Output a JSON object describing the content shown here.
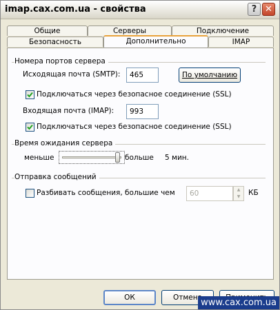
{
  "window": {
    "title": "imap.cax.com.ua - свойства",
    "help_label": "?",
    "close_label": "✕"
  },
  "tabs": {
    "row1": [
      "Общие",
      "Серверы",
      "Подключение"
    ],
    "row2": [
      "Безопасность",
      "Дополнительно",
      "IMAP"
    ],
    "active": "Дополнительно"
  },
  "ports": {
    "group_title": "Номера портов сервера",
    "smtp_label_pre": "Исходящая почта (SMTP):",
    "smtp_value": "465",
    "defaults_button": "По умолчанию",
    "smtp_ssl_label": "Подключаться через безопасное соединение (SSL)",
    "smtp_ssl_checked": true,
    "imap_label": "Входящая почта (IMAP):",
    "imap_value": "993",
    "imap_ssl_label": "Подключаться через безопасное соединение (SSL)",
    "imap_ssl_checked": true
  },
  "timeout": {
    "group_title": "Время ожидания сервера",
    "less_label": "меньше",
    "more_label": "больше",
    "value_label": "5 мин."
  },
  "sending": {
    "group_title": "Отправка сообщений",
    "split_label": "Разбивать сообщения, большие чем",
    "split_checked": false,
    "split_value": "60",
    "unit_label": "КБ"
  },
  "footer": {
    "ok_label": "ОК",
    "cancel_label": "Отмена",
    "apply_label": "Применить"
  },
  "watermark": "www.cax.com.ua"
}
